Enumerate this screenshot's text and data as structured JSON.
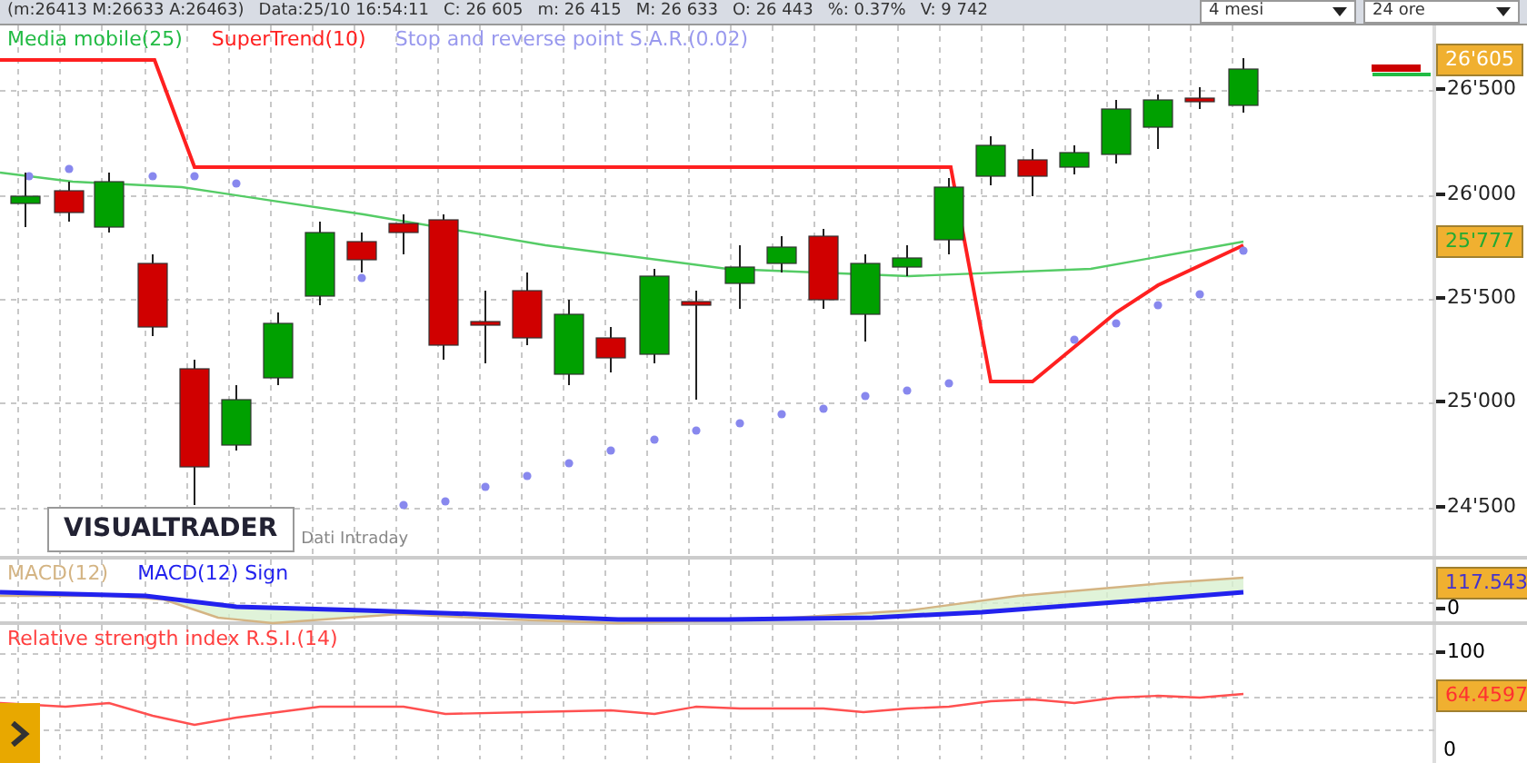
{
  "quote_bar": {
    "items": [
      "(m:26413 M:26633 A:26463)",
      "Data:25/10 16:54:11",
      "C: 26 605",
      "m: 26 415",
      "M: 26 633",
      "O: 26 443",
      "%: 0.37%",
      "V: 9 742"
    ],
    "selects": [
      {
        "value": "4 mesi"
      },
      {
        "value": "24 ore"
      }
    ]
  },
  "price_panel": {
    "legend": [
      {
        "label": "Media mobile(25)",
        "color": "#22bb44"
      },
      {
        "label": "SuperTrend(10)",
        "color": "#ff2020"
      },
      {
        "label": "Stop and reverse point S.A.R.(0.02)",
        "color": "#9999ee"
      }
    ],
    "axis_labels": [
      "26'500",
      "26'000",
      "25'500",
      "25'000",
      "24'500"
    ],
    "last_price": "26'605",
    "ma_value": "25'777",
    "logo": "VISUALTRADER",
    "source": "Dati Intraday"
  },
  "macd_panel": {
    "legend": [
      {
        "label": "MACD(12)",
        "color": "#d4b483"
      },
      {
        "label": "MACD(12) Sign",
        "color": "#2222ee"
      }
    ],
    "value": "117.543",
    "axis_labels": [
      "0"
    ]
  },
  "rsi_panel": {
    "legend": [
      {
        "label": "Relative strength index R.S.I.(14)",
        "color": "#ff4040"
      }
    ],
    "value": "64.4597",
    "axis_labels": [
      "100",
      "0"
    ]
  }
}
